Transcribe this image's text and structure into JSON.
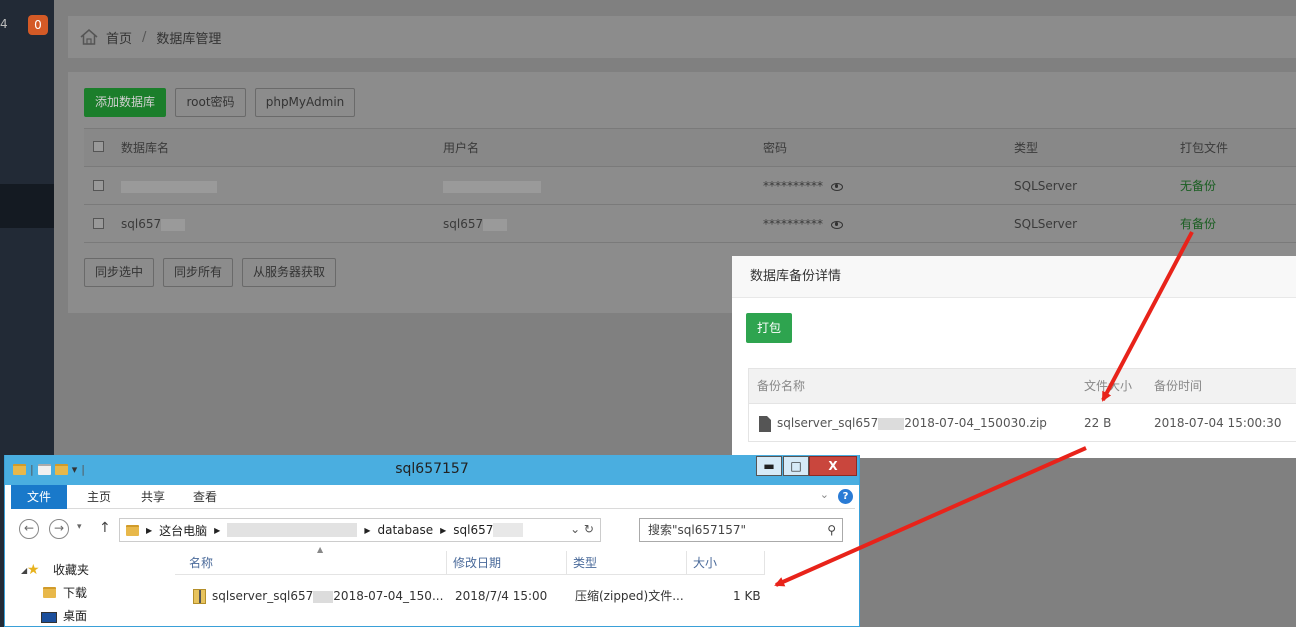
{
  "sidebar": {
    "partial_num": "4",
    "badge": "0"
  },
  "breadcrumb": {
    "home": "首页",
    "separator": "/",
    "current": "数据库管理"
  },
  "toolbar": {
    "add_db": "添加数据库",
    "root_pwd": "root密码",
    "phpmyadmin": "phpMyAdmin"
  },
  "db_table": {
    "headers": {
      "name": "数据库名",
      "user": "用户名",
      "password": "密码",
      "type": "类型",
      "pack": "打包文件"
    },
    "rows": [
      {
        "name": "",
        "user": "",
        "password": "**********",
        "type": "SQLServer",
        "pack": "无备份"
      },
      {
        "name": "sql657",
        "user": "sql657",
        "password": "**********",
        "type": "SQLServer",
        "pack": "有备份"
      }
    ]
  },
  "bottom_buttons": {
    "sync_selected": "同步选中",
    "sync_all": "同步所有",
    "fetch_server": "从服务器获取"
  },
  "modal": {
    "title": "数据库备份详情",
    "pack_button": "打包",
    "headers": {
      "name": "备份名称",
      "size": "文件大小",
      "time": "备份时间"
    },
    "row": {
      "name_prefix": "sqlserver_sql657",
      "name_suffix": "2018-07-04_150030.zip",
      "size": "22 B",
      "time": "2018-07-04 15:00:30"
    }
  },
  "explorer": {
    "title": "sql657157",
    "window_controls": {
      "minimize": "▬",
      "maximize": "□",
      "close": "X"
    },
    "ribbon": {
      "file": "文件",
      "home": "主页",
      "share": "共享",
      "view": "查看"
    },
    "address": {
      "this_pc": "这台电脑",
      "database": "database",
      "folder": "sql657"
    },
    "search_placeholder": "搜索\"sql657157\"",
    "nav": {
      "favorites": "收藏夹",
      "downloads": "下载",
      "desktop": "桌面"
    },
    "columns": {
      "name": "名称",
      "modified": "修改日期",
      "type": "类型",
      "size": "大小"
    },
    "file": {
      "name_prefix": "sqlserver_sql657",
      "name_suffix": "2018-07-04_150...",
      "modified": "2018/7/4 15:00",
      "type": "压缩(zipped)文件...",
      "size": "1 KB"
    }
  },
  "colors": {
    "accent_green": "#2ea44f",
    "arrow_red": "#e8231a",
    "explorer_blue": "#4aaee0"
  }
}
